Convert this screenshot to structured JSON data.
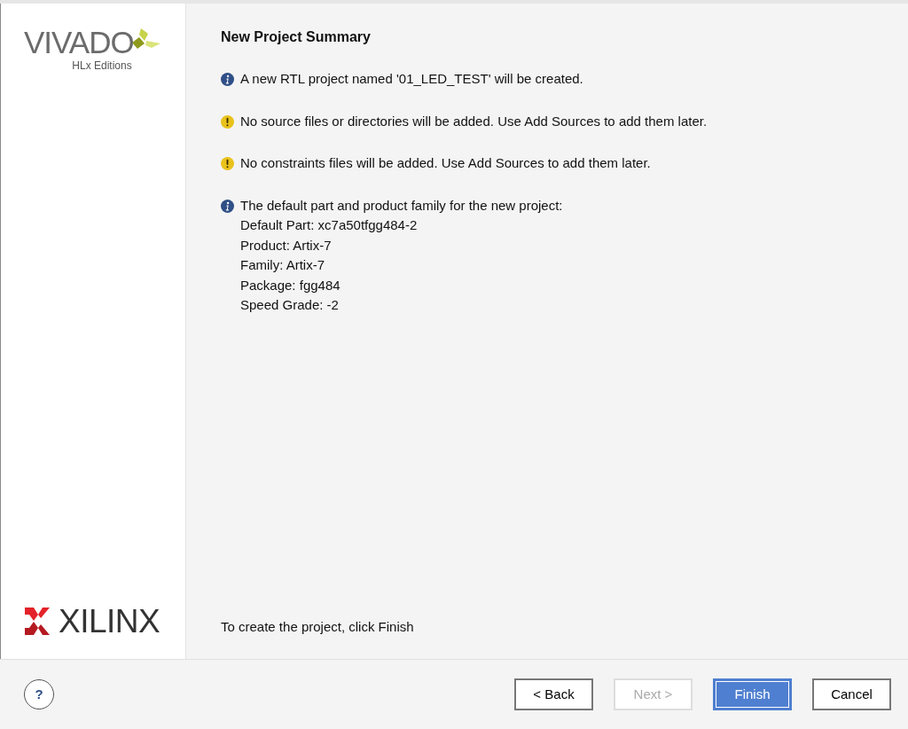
{
  "sidebar": {
    "product_logo": {
      "name": "VIVADO",
      "edition": "HLx Editions"
    },
    "company_logo": {
      "name": "XILINX"
    }
  },
  "page": {
    "title": "New Project Summary",
    "messages": [
      {
        "kind": "info",
        "text": "A new RTL project named '01_LED_TEST' will be created."
      },
      {
        "kind": "warning",
        "text": "No source files or directories will be added. Use Add Sources to add them later."
      },
      {
        "kind": "warning",
        "text": "No constraints files will be added. Use Add Sources to add them later."
      },
      {
        "kind": "info",
        "text": "The default part and product family for the new project:",
        "details": [
          "Default Part: xc7a50tfgg484-2",
          "Product: Artix-7",
          "Family: Artix-7",
          "Package: fgg484",
          "Speed Grade: -2"
        ]
      }
    ],
    "footer_text": "To create the project, click Finish"
  },
  "help_button": {
    "label": "?"
  },
  "buttons": [
    {
      "label": "< Back",
      "disabled": false,
      "focused": false
    },
    {
      "label": "Next >",
      "disabled": true,
      "focused": false
    },
    {
      "label": "Finish",
      "disabled": false,
      "focused": true
    },
    {
      "label": "Cancel",
      "disabled": false,
      "focused": false
    }
  ]
}
